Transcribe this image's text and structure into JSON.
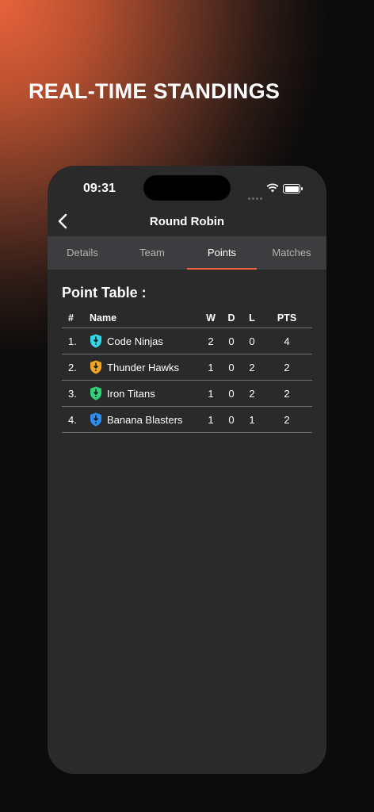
{
  "headline": "REAL-TIME STANDINGS",
  "status_bar": {
    "time": "09:31"
  },
  "nav": {
    "title": "Round Robin"
  },
  "tabs": [
    {
      "label": "Details"
    },
    {
      "label": "Team"
    },
    {
      "label": "Points",
      "active": true
    },
    {
      "label": "Matches"
    }
  ],
  "section_title": "Point Table :",
  "table": {
    "headers": {
      "num": "#",
      "name": "Name",
      "w": "W",
      "d": "D",
      "l": "L",
      "pts": "PTS"
    },
    "rows": [
      {
        "rank": "1.",
        "name": "Code Ninjas",
        "w": "2",
        "d": "0",
        "l": "0",
        "pts": "4",
        "color": "#31d8e6"
      },
      {
        "rank": "2.",
        "name": "Thunder Hawks",
        "w": "1",
        "d": "0",
        "l": "2",
        "pts": "2",
        "color": "#f0a71f"
      },
      {
        "rank": "3.",
        "name": "Iron Titans",
        "w": "1",
        "d": "0",
        "l": "2",
        "pts": "2",
        "color": "#2fd47a"
      },
      {
        "rank": "4.",
        "name": "Banana Blasters",
        "w": "1",
        "d": "0",
        "l": "1",
        "pts": "2",
        "color": "#2f8cf0"
      }
    ]
  },
  "colors": {
    "accent": "#e8623c",
    "panel": "#2b2a2b",
    "tabs_bg": "#3d3c3e"
  }
}
